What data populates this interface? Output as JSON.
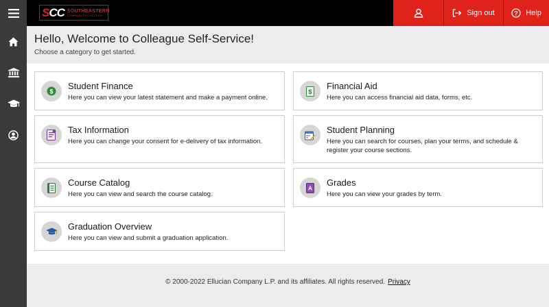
{
  "header": {
    "logo_mark_a": "S",
    "logo_mark_b": "CC",
    "logo_line1": "SOUTHEASTERN",
    "logo_line2": "COMMUNITY COLLEGE",
    "sign_out_label": "Sign out",
    "help_label": "Help",
    "accent_color": "#e0221b"
  },
  "sidebar": {
    "items": [
      {
        "icon": "menu-icon"
      },
      {
        "icon": "home-icon"
      },
      {
        "icon": "institution-icon"
      },
      {
        "icon": "graduation-cap-icon"
      },
      {
        "icon": "user-circle-icon"
      }
    ]
  },
  "welcome": {
    "title": "Hello, Welcome to Colleague Self-Service!",
    "subtitle": "Choose a category to get started."
  },
  "cards": [
    {
      "title": "Student Finance",
      "description": "Here you can view your latest statement and make a payment online.",
      "icon": "dollar-icon"
    },
    {
      "title": "Financial Aid",
      "description": "Here you can access financial aid data, forms, etc.",
      "icon": "financial-aid-icon"
    },
    {
      "title": "Tax Information",
      "description": "Here you can change your consent for e-delivery of tax information.",
      "icon": "tax-document-icon"
    },
    {
      "title": "Student Planning",
      "description": "Here you can search for courses, plan your terms, and schedule & register your course sections.",
      "icon": "calendar-pencil-icon"
    },
    {
      "title": "Course Catalog",
      "description": "Here you can view and search the course catalog.",
      "icon": "catalog-book-icon"
    },
    {
      "title": "Grades",
      "description": "Here you can view your grades by term.",
      "icon": "grades-icon"
    },
    {
      "title": "Graduation Overview",
      "description": "Here you can view and submit a graduation application.",
      "icon": "graduation-cap-icon"
    }
  ],
  "footer": {
    "copyright": "© 2000-2022 Ellucian Company L.P. and its affiliates. All rights reserved.",
    "privacy_label": "Privacy"
  }
}
